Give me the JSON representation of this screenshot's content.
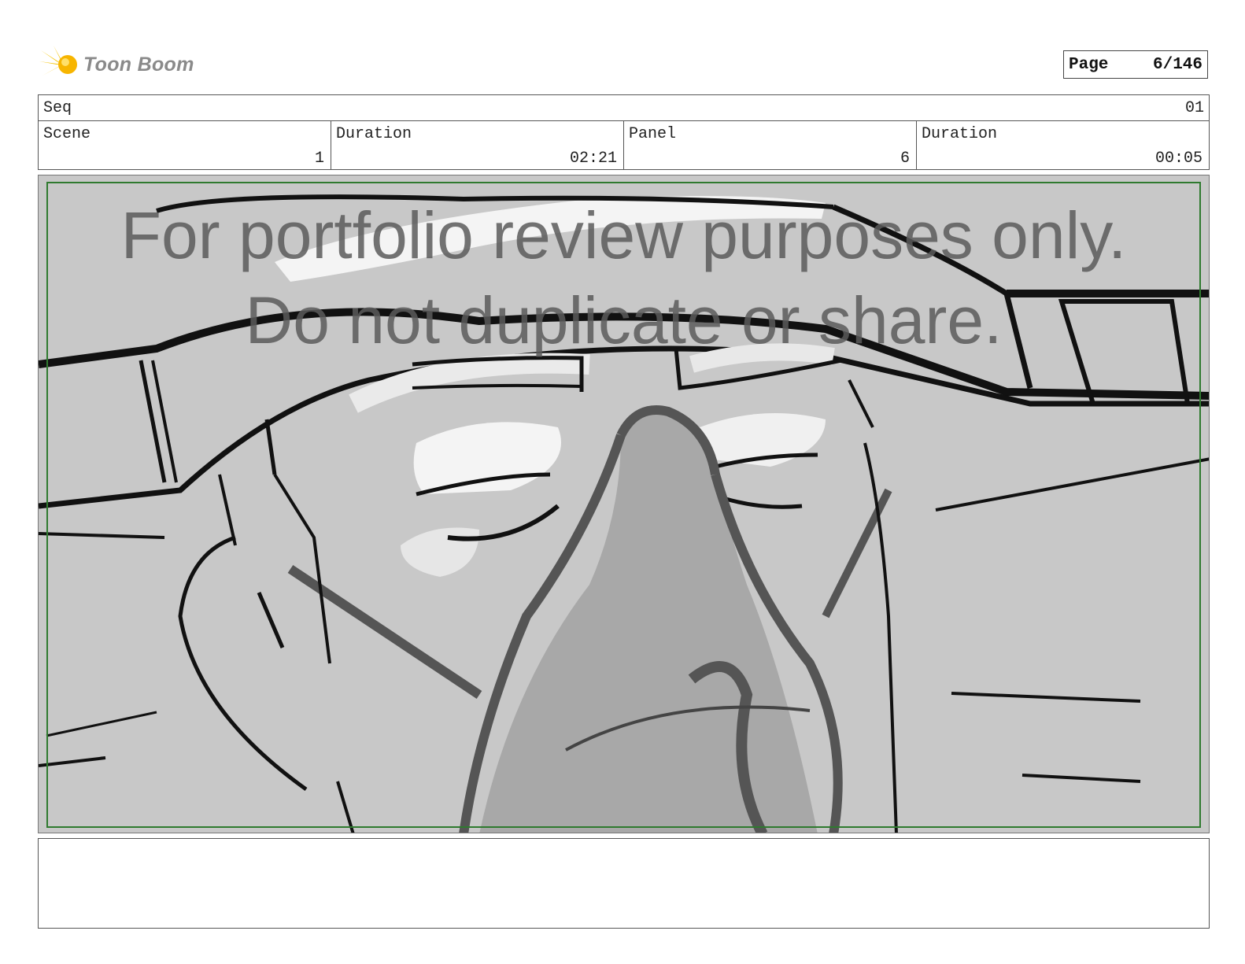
{
  "brand": {
    "name": "Toon Boom",
    "logo_icon": "starburst-logo-icon",
    "accent": "#f5c400"
  },
  "page": {
    "label": "Page",
    "value": "6/146"
  },
  "header": {
    "seq_label": "Seq",
    "seq_value": "01",
    "scene_label": "Scene",
    "scene_value": "1",
    "scene_duration_label": "Duration",
    "scene_duration_value": "02:21",
    "panel_label": "Panel",
    "panel_value": "6",
    "panel_duration_label": "Duration",
    "panel_duration_value": "00:05"
  },
  "panel": {
    "watermark_line1": "For portfolio review purposes only.",
    "watermark_line2": "Do not duplicate or share.",
    "safe_frame_color": "#2f7a2f"
  },
  "notes": {
    "text": ""
  }
}
